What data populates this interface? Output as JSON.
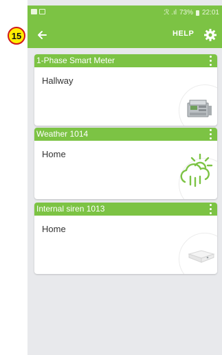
{
  "step_badge": "15",
  "status_bar": {
    "signal_text": "ℛ .ıl",
    "battery": "73%",
    "time": "22:01"
  },
  "app_bar": {
    "back_icon": "arrow-left-icon",
    "help_label": "HELP",
    "settings_icon": "gear-icon"
  },
  "devices": [
    {
      "title": "1-Phase Smart Meter",
      "location": "Hallway",
      "icon": "smart-meter-icon"
    },
    {
      "title": "Weather 1014",
      "location": "Home",
      "icon": "weather-cloud-sun-icon"
    },
    {
      "title": "Internal siren 1013",
      "location": "Home",
      "icon": "siren-device-icon"
    }
  ],
  "colors": {
    "accent": "#7cc344",
    "background": "#e8e9ec",
    "card": "#ffffff"
  }
}
